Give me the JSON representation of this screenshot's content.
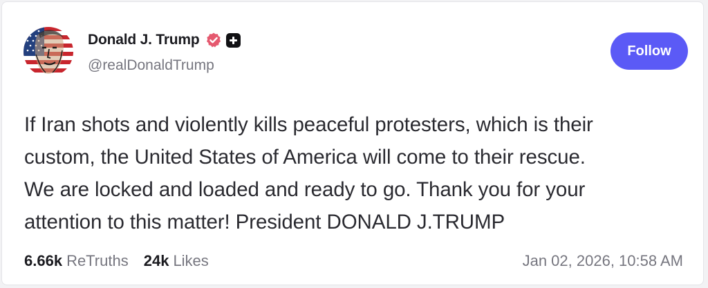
{
  "post": {
    "author": {
      "display_name": "Donald J. Trump",
      "handle": "@realDonaldTrump",
      "verified_badge_icon": "verified-badge-icon",
      "plus_badge_icon": "plus-badge-icon",
      "verified_color": "#e5596f"
    },
    "follow_label": "Follow",
    "follow_color": "#5b5af6",
    "text": "If Iran shots and violently kills peaceful protesters, which is their\ncustom, the United States of America will come to their rescue.\nWe are locked and loaded and ready to go. Thank you for your\nattention to this matter! President DONALD J.TRUMP",
    "stats": {
      "retruths_count": "6.66k",
      "retruths_label": "ReTruths",
      "likes_count": "24k",
      "likes_label": "Likes"
    },
    "timestamp": "Jan 02, 2026, 10:58 AM"
  }
}
